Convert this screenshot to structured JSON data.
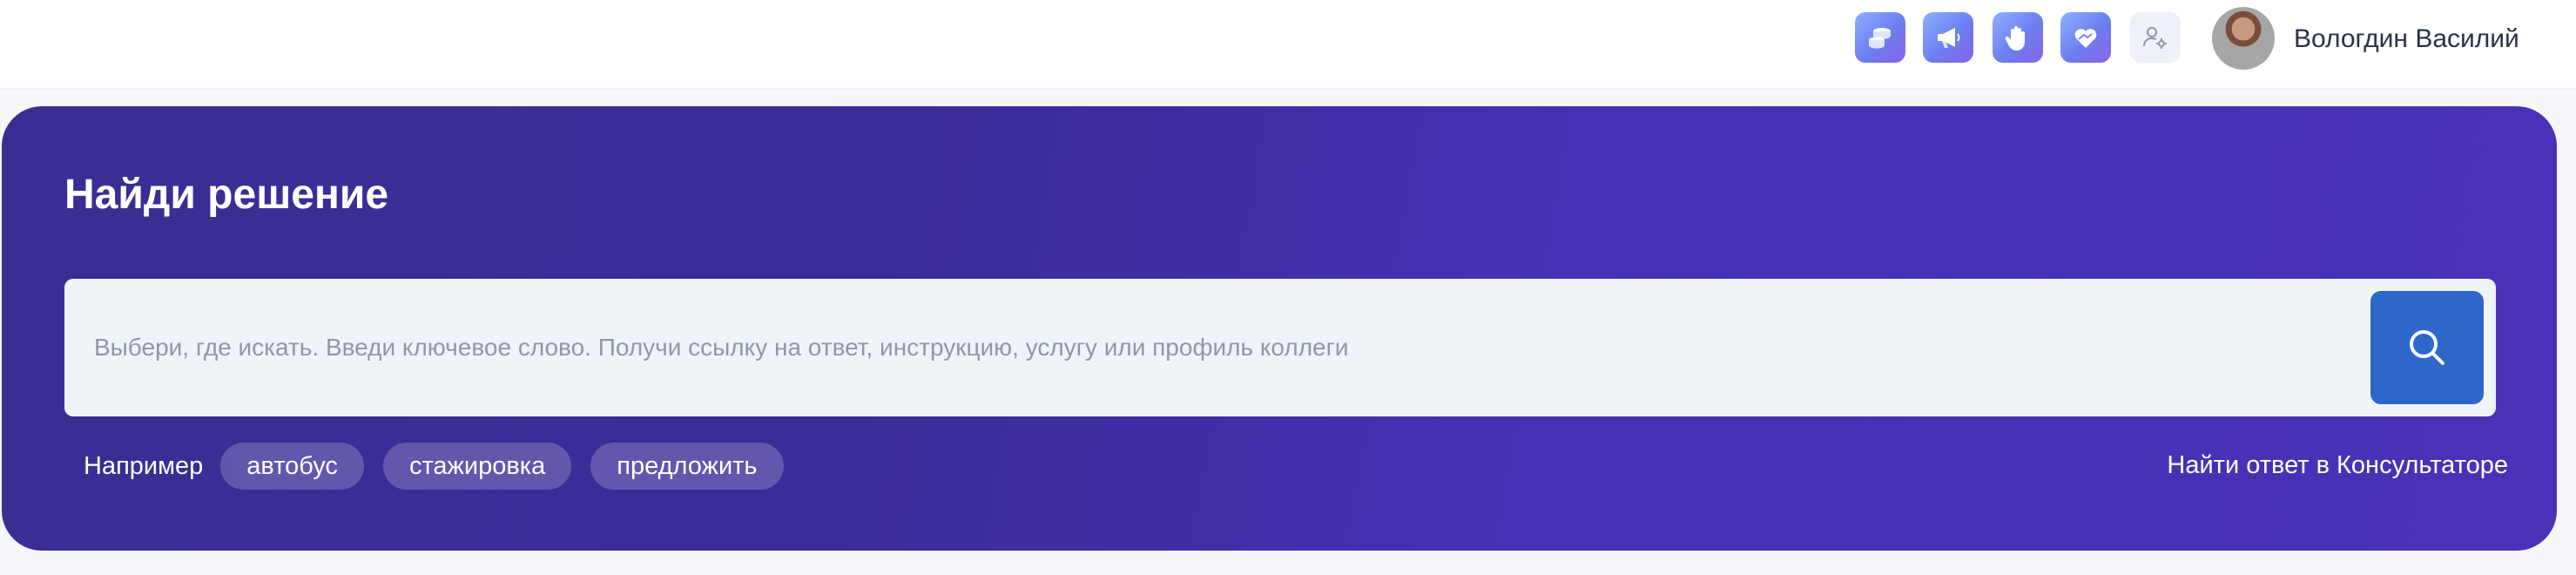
{
  "header": {
    "icons": [
      {
        "name": "coins-icon"
      },
      {
        "name": "megaphone-icon"
      },
      {
        "name": "wave-hand-icon"
      },
      {
        "name": "heart-hands-icon"
      },
      {
        "name": "user-settings-icon"
      }
    ],
    "user_name": "Вологдин Василий"
  },
  "hero": {
    "title": "Найди решение",
    "search": {
      "placeholder": "Выбери, где искать. Введи ключевое слово. Получи ссылку на ответ, инструкцию, услугу или профиль коллеги",
      "value": ""
    },
    "examples_label": "Например",
    "examples": [
      "автобус",
      "стажировка",
      "предложить"
    ],
    "consultant_link": "Найти ответ в Консультаторе"
  },
  "colors": {
    "hero_start": "#3a2e94",
    "hero_end": "#4a31b8",
    "search_button": "#2c67c9",
    "search_background": "#f0f4f9"
  }
}
